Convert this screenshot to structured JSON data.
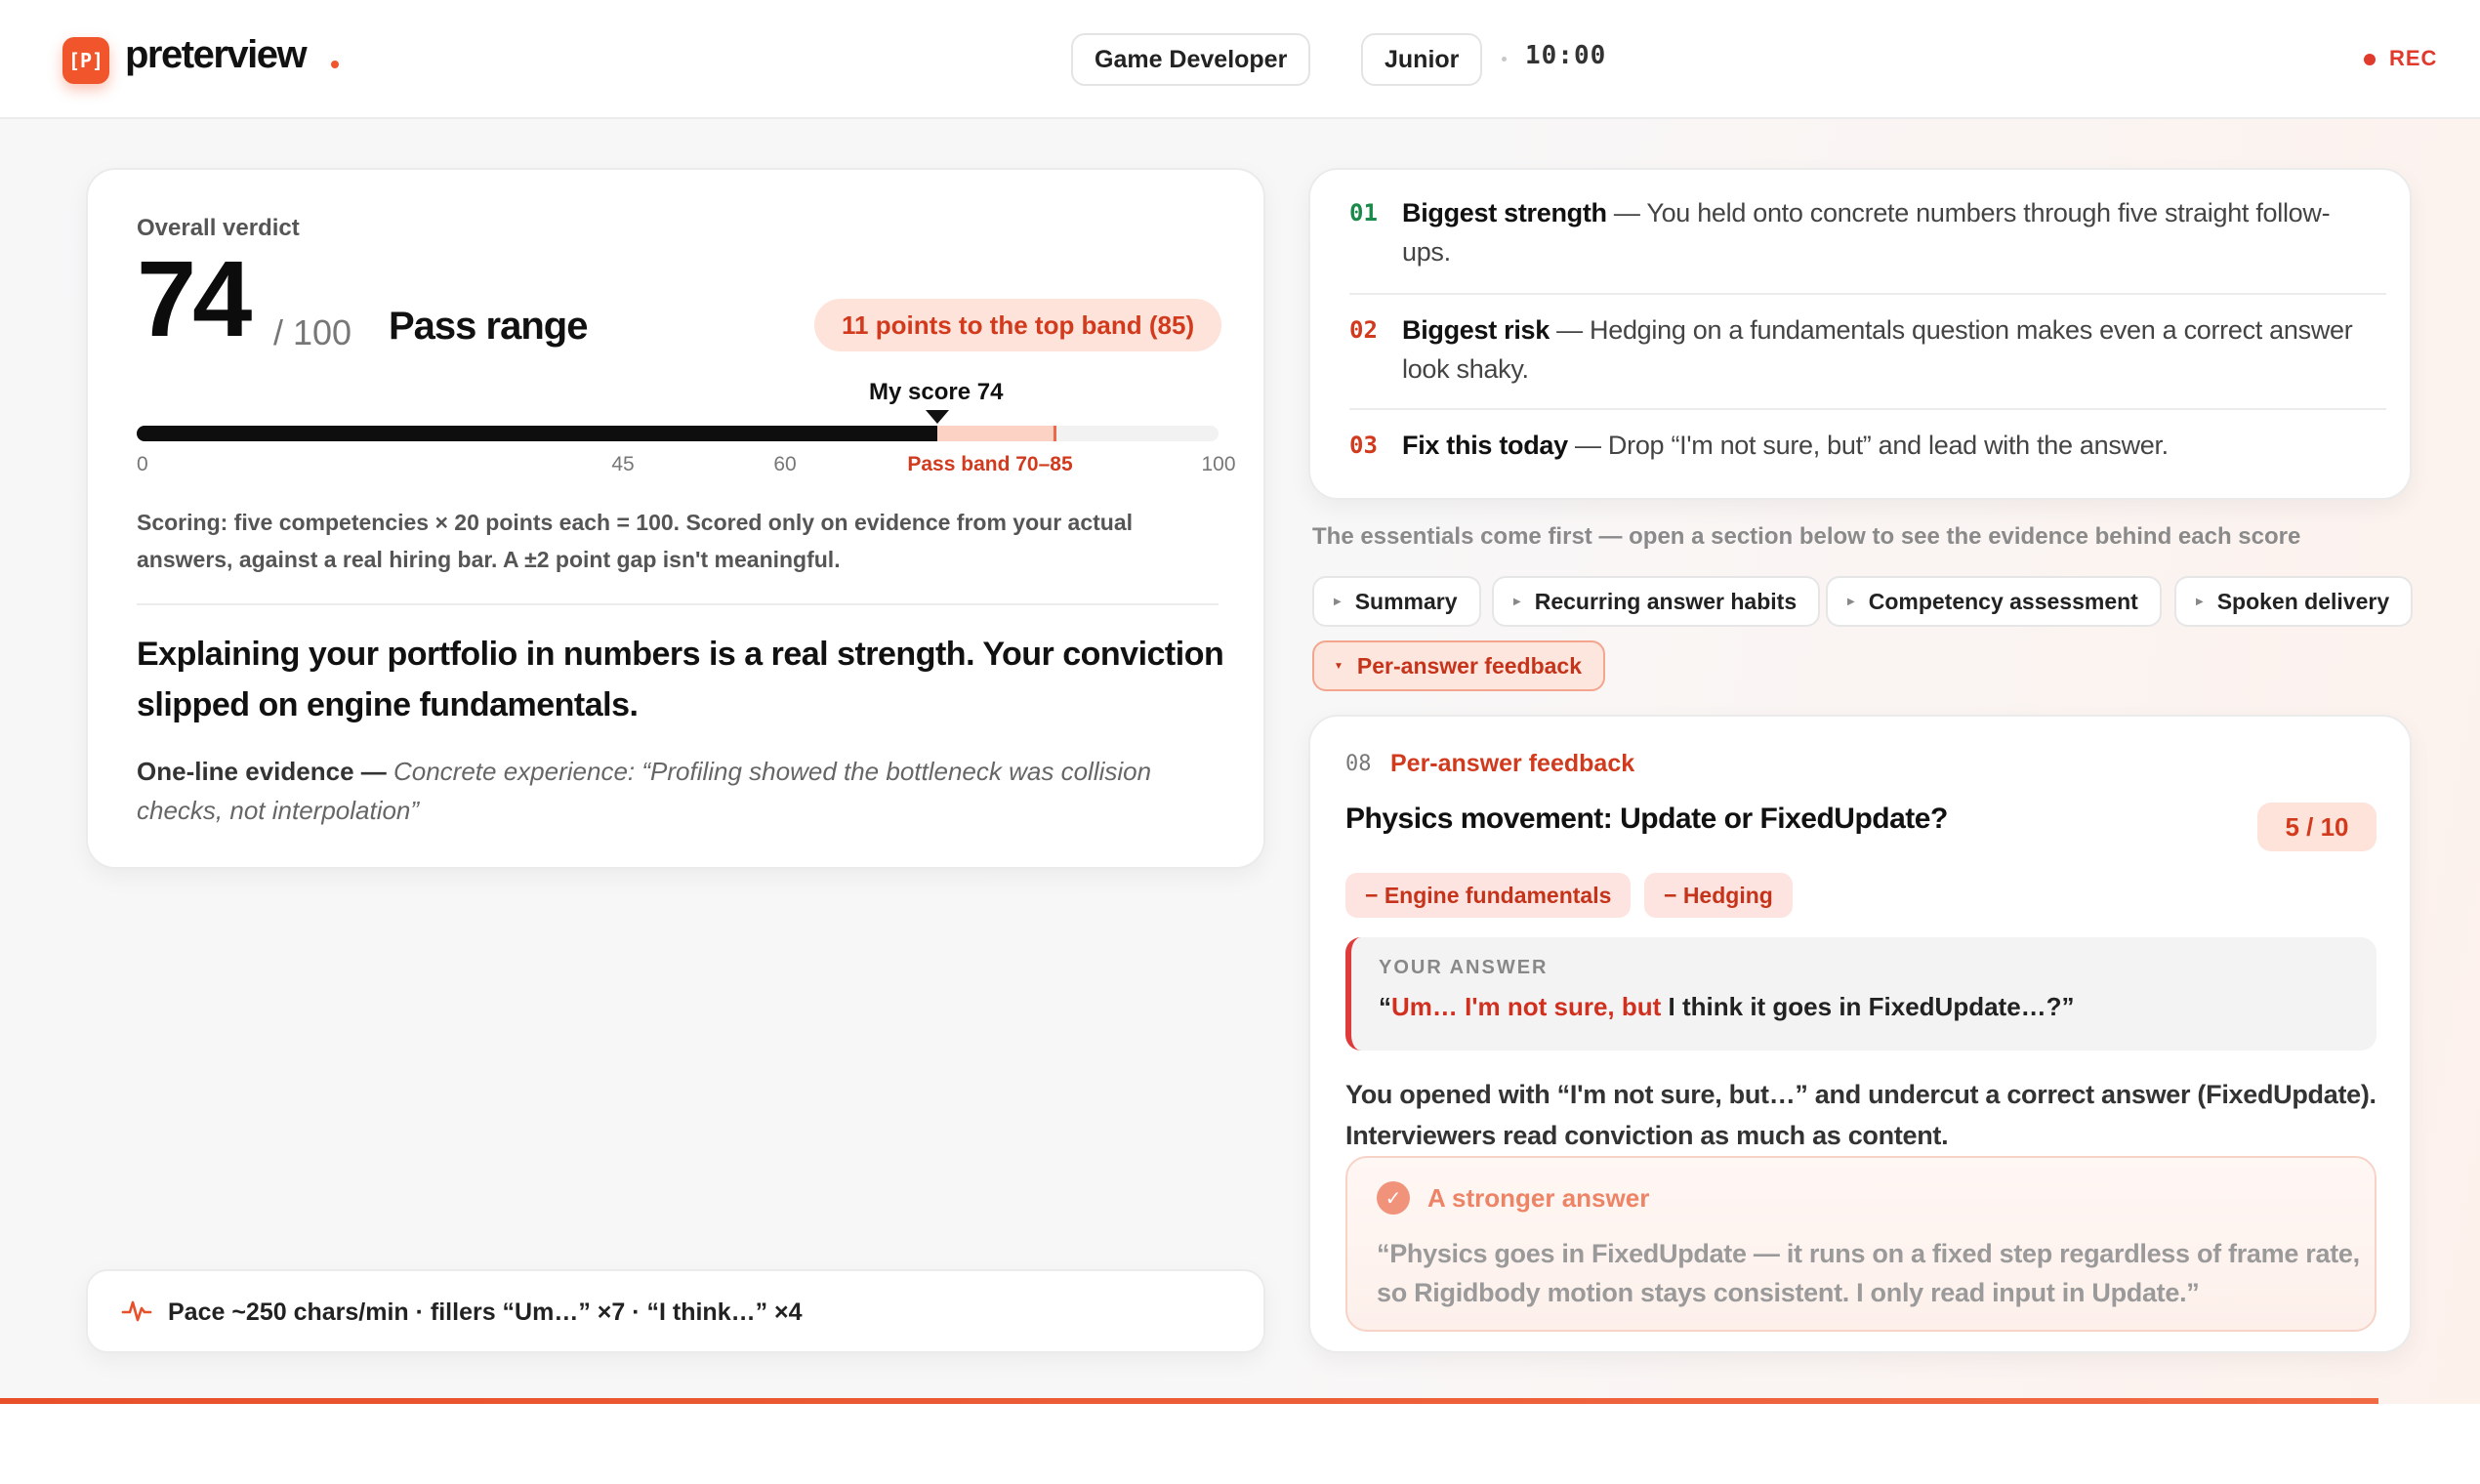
{
  "header": {
    "logo_mark": "[P]",
    "brand": "preterview",
    "role": "Game Developer",
    "level": "Junior",
    "timer": "10:00",
    "rec": "REC"
  },
  "verdict": {
    "label": "Overall verdict",
    "score": "74",
    "out_of": "/ 100",
    "range_label": "Pass range",
    "top_band_pill": "11 points to the top band (85)",
    "my_score_label": "My score 74",
    "bar": {
      "score": 74,
      "band_min": 70,
      "band_max": 85,
      "max": 100
    },
    "ticks": {
      "t0": "0",
      "t45": "45",
      "t60": "60",
      "band": "Pass band 70–85",
      "t100": "100"
    },
    "scoring_note": "Scoring: five competencies × 20 points each = 100. Scored only on evidence from your actual answers, against a real hiring bar. A ±2 point gap isn't meaningful.",
    "headline": "Explaining your portfolio in numbers is a real strength. Your conviction slipped on engine fundamentals.",
    "evidence_label": "One-line evidence —",
    "evidence_quote": "Concrete experience: “Profiling showed the bottleneck was collision checks, not interpolation”"
  },
  "pace": {
    "icon": "activity-pulse-icon",
    "text": "Pace ~250 chars/min · fillers “Um…” ×7 · “I think…” ×4"
  },
  "insights": [
    {
      "num": "01",
      "title": "Biggest strength",
      "text": " — You held onto concrete numbers through five straight follow-ups.",
      "color": "#1a8a4a"
    },
    {
      "num": "02",
      "title": "Biggest risk",
      "text": " — Hedging on a fundamentals question makes even a correct answer look shaky.",
      "color": "#d23a1d"
    },
    {
      "num": "03",
      "title": "Fix this today",
      "text": " — Drop “I'm not sure, but” and lead with the answer.",
      "color": "#d23a1d"
    }
  ],
  "essentials_hint": "The essentials come first — open a section below to see the evidence behind each score",
  "sections": [
    "Summary",
    "Recurring answer habits",
    "Competency assessment",
    "Spoken delivery",
    "Per-answer feedback"
  ],
  "feedback": {
    "num": "08",
    "section": "Per-answer feedback",
    "question": "Physics movement: Update or FixedUpdate?",
    "score": "5 / 10",
    "tags": [
      "− Engine fundamentals",
      "− Hedging"
    ],
    "answer_label": "YOUR ANSWER",
    "answer_open": "“",
    "answer_hedge": "Um… I'm not sure, but",
    "answer_rest": " I think it goes in FixedUpdate…?”",
    "explanation": "You opened with “I'm not sure, but…” and undercut a correct answer (FixedUpdate). Interviewers read conviction as much as content.",
    "stronger_label": "A stronger answer",
    "stronger_text": "“Physics goes in FixedUpdate — it runs on a fixed step regardless of frame rate, so Rigidbody motion stays consistent. I only read input in Update.”"
  },
  "colors": {
    "accent": "#f0552b",
    "danger": "#d23a1d",
    "success": "#1a8a4a"
  }
}
